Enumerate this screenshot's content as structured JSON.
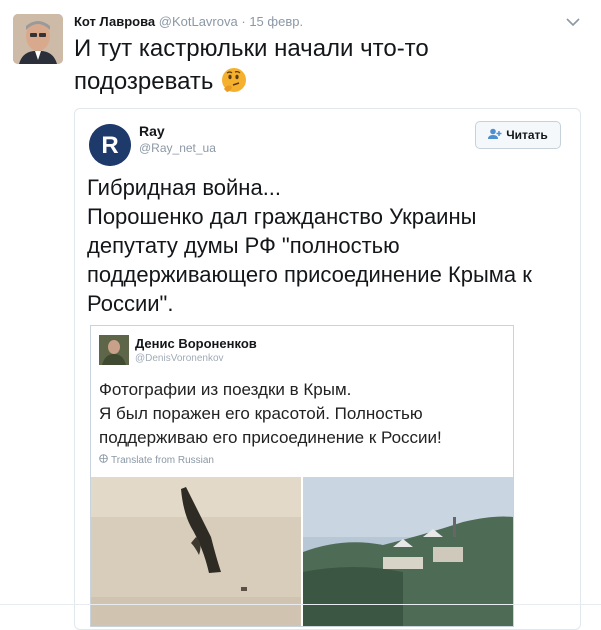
{
  "tweet": {
    "author_name": "Кот Лаврова",
    "author_handle": "@KotLavrova",
    "separator": "·",
    "date": "15 февр.",
    "text": "И тут кастрюльки начали что-то подозревать",
    "emoji": "thinking-face-icon"
  },
  "quoted": {
    "author_name": "Ray",
    "author_handle": "@Ray_net_ua",
    "follow_label": "Читать",
    "avatar_letter": "R",
    "lines": [
      "Гибридная война...",
      "Порошенко дал гражданство Украины",
      "депутату думы РФ \"полностью",
      "поддерживающего присоединение Крыма к",
      "России\"."
    ]
  },
  "embedded": {
    "author_name": "Денис Вороненков",
    "author_handle": "@DenisVoronenkov",
    "lines": [
      "Фотографии из поездки в Крым.",
      "Я был поражен его красотой. Полностью",
      "поддерживаю его присоединение к России!"
    ],
    "translate_label": "Translate from Russian"
  },
  "colors": {
    "text": "#14171a",
    "muted": "#8b98a5",
    "border": "#e1e8ed",
    "ray_brand": "#1d3a6b"
  }
}
